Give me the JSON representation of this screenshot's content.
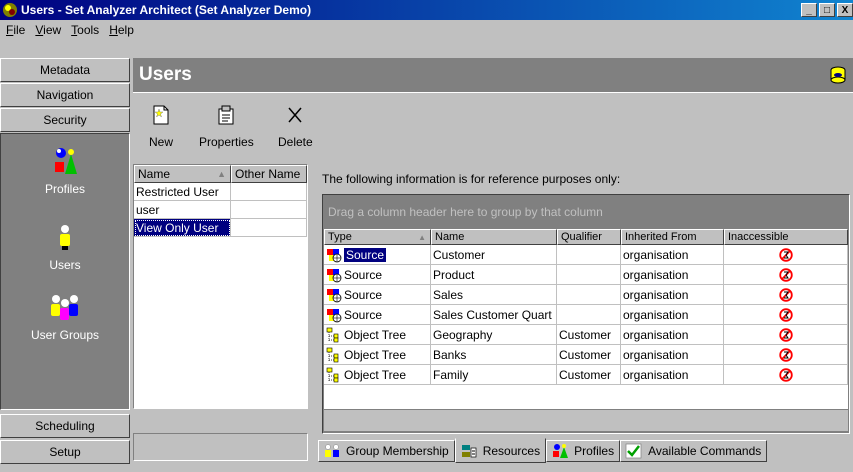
{
  "window": {
    "title": "Users - Set Analyzer Architect (Set Analyzer Demo)",
    "min": "_",
    "max": "□",
    "close": "X"
  },
  "menu": [
    {
      "label": "File",
      "key": "F",
      "rest": "ile"
    },
    {
      "label": "View",
      "key": "V",
      "rest": "iew"
    },
    {
      "label": "Tools",
      "key": "T",
      "rest": "ools"
    },
    {
      "label": "Help",
      "key": "H",
      "rest": "elp"
    }
  ],
  "nav": {
    "buttons": {
      "metadata": "Metadata",
      "navigation": "Navigation",
      "security": "Security",
      "scheduling": "Scheduling",
      "setup": "Setup"
    },
    "items": {
      "profiles": "Profiles",
      "users": "Users",
      "user_groups": "User Groups"
    }
  },
  "page": {
    "title": "Users"
  },
  "toolbar": {
    "new": "New",
    "properties": "Properties",
    "delete": "Delete"
  },
  "users_list": {
    "columns": {
      "name": "Name",
      "other": "Other Name"
    },
    "rows": [
      "Restricted User",
      "user",
      "View Only User"
    ]
  },
  "info": "The following information is for reference purposes only:",
  "grid": {
    "group_hint": "Drag a column header here to group by that column",
    "columns": {
      "type": "Type",
      "name": "Name",
      "qualifier": "Qualifier",
      "inherited": "Inherited From",
      "inaccessible": "Inaccessible"
    },
    "rows": [
      {
        "type": "Source",
        "name": "Customer",
        "qualifier": "",
        "inherited": "organisation"
      },
      {
        "type": "Source",
        "name": "Product",
        "qualifier": "",
        "inherited": "organisation"
      },
      {
        "type": "Source",
        "name": "Sales",
        "qualifier": "",
        "inherited": "organisation"
      },
      {
        "type": "Source",
        "name": "Sales Customer Quart",
        "qualifier": "",
        "inherited": "organisation"
      },
      {
        "type": "Object Tree",
        "name": "Geography",
        "qualifier": "Customer",
        "inherited": "organisation"
      },
      {
        "type": "Object Tree",
        "name": "Banks",
        "qualifier": "Customer",
        "inherited": "organisation"
      },
      {
        "type": "Object Tree",
        "name": "Family",
        "qualifier": "Customer",
        "inherited": "organisation"
      }
    ]
  },
  "tabs": {
    "group_membership": "Group Membership",
    "resources": "Resources",
    "profiles": "Profiles",
    "available_commands": "Available Commands"
  }
}
